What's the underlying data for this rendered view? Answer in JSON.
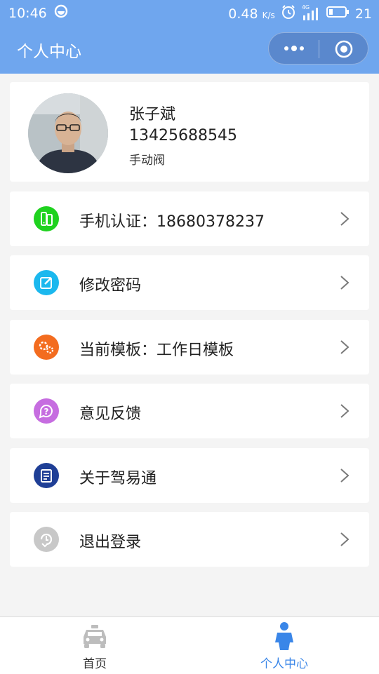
{
  "status_bar": {
    "time": "10:46",
    "speed_value": "0.48",
    "speed_unit": "K/s",
    "battery_level": "21",
    "network_label": "4G",
    "icons": [
      "weibo-icon",
      "alarm-icon",
      "signal-icon",
      "battery-icon"
    ]
  },
  "nav": {
    "title": "个人中心",
    "more_icon": "more-dots-icon",
    "close_icon": "target-circle-icon"
  },
  "profile": {
    "name": "张子斌",
    "phone": "13425688545",
    "valve": "手动阀"
  },
  "menu": [
    {
      "label": "手机认证：18680378237",
      "icon": "phone-verify-icon",
      "color": "#1fd21f"
    },
    {
      "label": "修改密码",
      "icon": "edit-icon",
      "color": "#1bb8ee"
    },
    {
      "label": "当前模板：工作日模板",
      "icon": "gears-icon",
      "color": "#f36c1f"
    },
    {
      "label": "意见反馈",
      "icon": "feedback-icon",
      "color": "#c66de0"
    },
    {
      "label": "关于驾易通",
      "icon": "about-icon",
      "color": "#1f3f96"
    },
    {
      "label": "退出登录",
      "icon": "logout-icon",
      "color": "#c8c8c8"
    }
  ],
  "tabs": [
    {
      "label": "首页",
      "icon": "car-icon",
      "active": false,
      "color": "#333333"
    },
    {
      "label": "个人中心",
      "icon": "person-icon",
      "active": true,
      "color": "#3a86e8"
    }
  ],
  "colors": {
    "header": "#6fa6ee",
    "background": "#f4f4f4",
    "tab_active": "#3a86e8",
    "tab_inactive_icon": "#bdbdbd"
  }
}
